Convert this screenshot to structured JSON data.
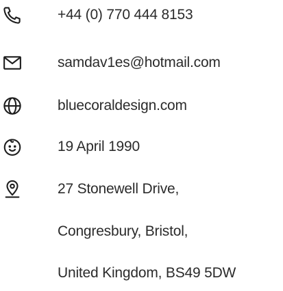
{
  "contact": {
    "phone": "+44 (0) 770 444 8153",
    "email": "samdav1es@hotmail.com",
    "website": "bluecoraldesign.com",
    "birthday": "19 April 1990",
    "address": {
      "line1": "27 Stonewell Drive,",
      "line2": "Congresbury, Bristol,",
      "line3": "United Kingdom, BS49 5DW"
    }
  },
  "icons": {
    "phone": "phone-icon",
    "email": "envelope-icon",
    "website": "globe-icon",
    "birthday": "baby-face-icon",
    "address": "location-pin-icon"
  },
  "colors": {
    "text": "#2b2b2b",
    "icon": "#1f1f1f",
    "background": "#ffffff"
  }
}
